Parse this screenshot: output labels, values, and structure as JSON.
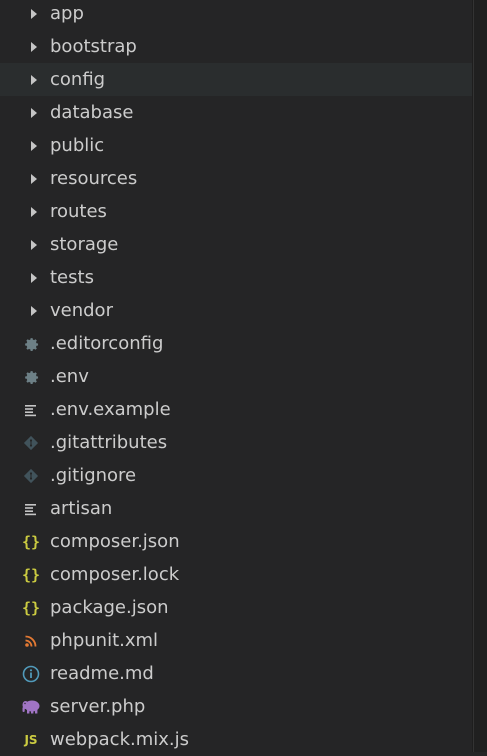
{
  "explorer": {
    "items": [
      {
        "label": "app",
        "kind": "folder",
        "icon": "chevron-right-icon"
      },
      {
        "label": "bootstrap",
        "kind": "folder",
        "icon": "chevron-right-icon"
      },
      {
        "label": "config",
        "kind": "folder",
        "icon": "chevron-right-icon",
        "hovered": true
      },
      {
        "label": "database",
        "kind": "folder",
        "icon": "chevron-right-icon"
      },
      {
        "label": "public",
        "kind": "folder",
        "icon": "chevron-right-icon"
      },
      {
        "label": "resources",
        "kind": "folder",
        "icon": "chevron-right-icon"
      },
      {
        "label": "routes",
        "kind": "folder",
        "icon": "chevron-right-icon"
      },
      {
        "label": "storage",
        "kind": "folder",
        "icon": "chevron-right-icon"
      },
      {
        "label": "tests",
        "kind": "folder",
        "icon": "chevron-right-icon"
      },
      {
        "label": "vendor",
        "kind": "folder",
        "icon": "chevron-right-icon"
      },
      {
        "label": ".editorconfig",
        "kind": "file",
        "icon": "gear-icon"
      },
      {
        "label": ".env",
        "kind": "file",
        "icon": "gear-icon"
      },
      {
        "label": ".env.example",
        "kind": "file",
        "icon": "text-lines-icon"
      },
      {
        "label": ".gitattributes",
        "kind": "file",
        "icon": "git-icon"
      },
      {
        "label": ".gitignore",
        "kind": "file",
        "icon": "git-icon"
      },
      {
        "label": "artisan",
        "kind": "file",
        "icon": "text-lines-icon"
      },
      {
        "label": "composer.json",
        "kind": "file",
        "icon": "json-braces-icon"
      },
      {
        "label": "composer.lock",
        "kind": "file",
        "icon": "json-braces-icon"
      },
      {
        "label": "package.json",
        "kind": "file",
        "icon": "json-braces-icon"
      },
      {
        "label": "phpunit.xml",
        "kind": "file",
        "icon": "rss-icon"
      },
      {
        "label": "readme.md",
        "kind": "file",
        "icon": "info-icon"
      },
      {
        "label": "server.php",
        "kind": "file",
        "icon": "elephant-icon"
      },
      {
        "label": "webpack.mix.js",
        "kind": "file",
        "icon": "js-icon"
      }
    ]
  },
  "icons": {
    "json_braces_text": "{}",
    "js_text": "JS"
  },
  "colors": {
    "background": "#252526",
    "hover_row": "#2a2d2e",
    "text": "#cccccc",
    "gear": "#6d8086",
    "git": "#41535b",
    "json": "#cbcb41",
    "rss": "#e37933",
    "info": "#519aba",
    "php": "#a074c4",
    "js": "#cbcb41"
  }
}
